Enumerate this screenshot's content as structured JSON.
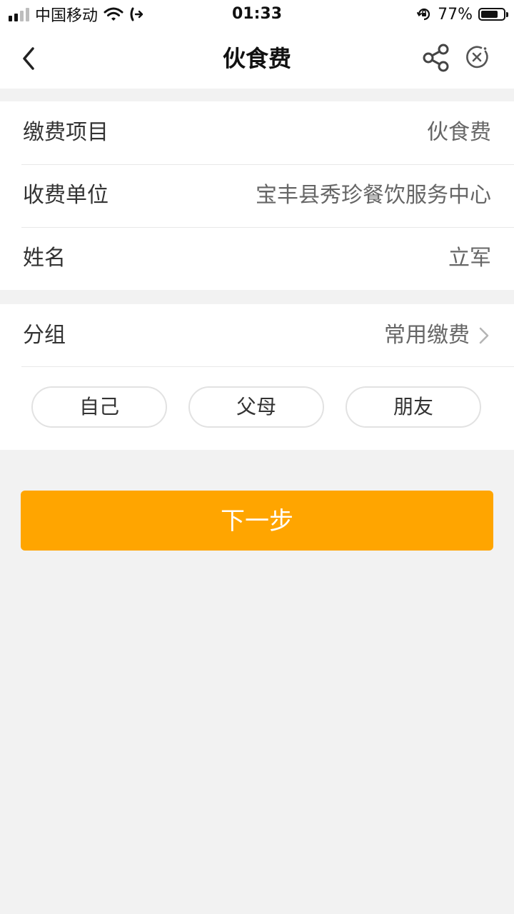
{
  "status_bar": {
    "carrier": "中国移动",
    "time": "01:33",
    "battery_percent": "77%",
    "battery_level": 0.77
  },
  "nav": {
    "title": "伙食费"
  },
  "details": {
    "rows": [
      {
        "label": "缴费项目",
        "value": "伙食费"
      },
      {
        "label": "收费单位",
        "value": "宝丰县秀珍餐饮服务中心"
      },
      {
        "label": "姓名",
        "value": "立军"
      }
    ]
  },
  "group": {
    "label": "分组",
    "value": "常用缴费",
    "chips": [
      "自己",
      "父母",
      "朋友"
    ]
  },
  "actions": {
    "next_label": "下一步"
  },
  "colors": {
    "accent": "#ffa500",
    "page_background": "#f2f2f2"
  },
  "icons": {
    "back": "back-chevron-icon",
    "share": "share-icon",
    "close": "close-circle-icon",
    "chevron": "chevron-right-icon",
    "wifi": "wifi-icon",
    "call": "call-forward-icon",
    "lock": "orientation-lock-icon"
  }
}
